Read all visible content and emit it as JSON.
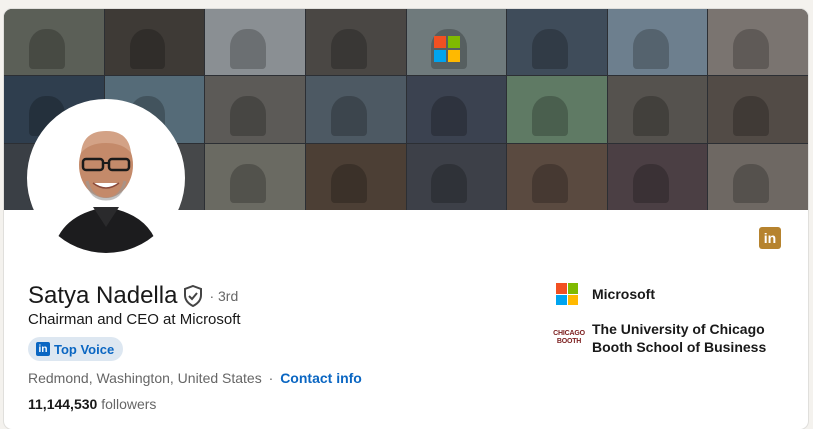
{
  "profile": {
    "name": "Satya Nadella",
    "degree": "· 3rd",
    "headline": "Chairman and CEO at Microsoft",
    "badge_label": "Top Voice",
    "location": "Redmond, Washington, United States",
    "separator": "·",
    "contact_label": "Contact info",
    "followers_count": "11,144,530",
    "followers_label": "followers"
  },
  "organizations": [
    {
      "name": "Microsoft",
      "icon": "microsoft-logo"
    },
    {
      "name_line1": "The University of Chicago",
      "name_line2": "Booth School of Business",
      "icon": "chicago-booth-logo",
      "logo_text_1": "CHICAGO",
      "logo_text_2": "BOOTH"
    }
  ],
  "icons": {
    "linkedin_badge": "in",
    "top_voice_icon": "in"
  },
  "colors": {
    "link_blue": "#0a66c2",
    "badge_bg": "#dde7f1",
    "linkedin_gold": "#b6832e"
  }
}
